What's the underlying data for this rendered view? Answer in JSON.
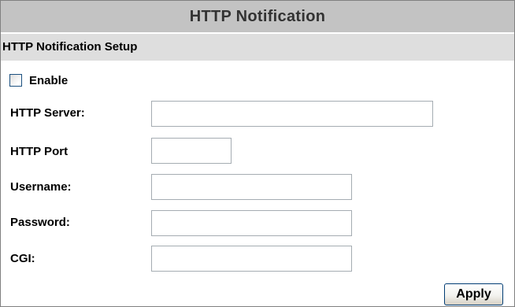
{
  "header": {
    "title": "HTTP Notification"
  },
  "section": {
    "title": "HTTP Notification Setup"
  },
  "enable": {
    "label": "Enable",
    "checked": false
  },
  "fields": {
    "server": {
      "label": "HTTP Server:",
      "value": ""
    },
    "port": {
      "label": "HTTP Port",
      "value": ""
    },
    "username": {
      "label": "Username:",
      "value": ""
    },
    "password": {
      "label": "Password:",
      "value": ""
    },
    "cgi": {
      "label": "CGI:",
      "value": ""
    }
  },
  "actions": {
    "apply_label": "Apply"
  },
  "colors": {
    "title_bar": "#c3c3c3",
    "section_bar": "#dedede",
    "input_border": "#a5acb2",
    "button_border": "#003c74"
  }
}
